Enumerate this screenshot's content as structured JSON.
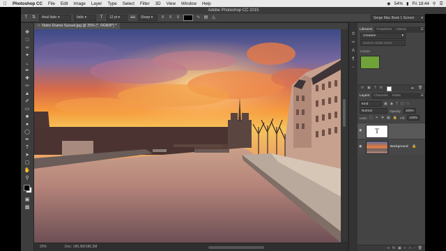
{
  "menubar": {
    "app": "Photoshop CC",
    "items": [
      "File",
      "Edit",
      "Image",
      "Layer",
      "Type",
      "Select",
      "Filter",
      "3D",
      "View",
      "Window",
      "Help"
    ],
    "battery": "54%",
    "clock": "Fri 18:44"
  },
  "window": {
    "title": "Adobe Photoshop CC 2015"
  },
  "options": {
    "font_family": "Arial Italic",
    "font_style": "Italic",
    "font_size": "12 pt",
    "aa_label": "aa",
    "antialias": "Sharp"
  },
  "workspace": "Serge Mac Book 1 Screen",
  "document": {
    "tab_close": "×",
    "tab_title": "Notre Drame Sunset.jpg @ 25% (*, RGB/8*) *",
    "zoom": "25%",
    "doc_info": "Doc: 186,3M/186,3M"
  },
  "libraries": {
    "tabs": [
      "Libraries",
      "Properties",
      "History"
    ],
    "library_name": "Creature",
    "search_placeholder": "Search Adobe Stock",
    "colors_label": "Colors",
    "color_hex": "#70a23a"
  },
  "layers": {
    "tabs": [
      "Layers",
      "Channels",
      "Paths"
    ],
    "kind": "Kind",
    "blend_mode": "Normal",
    "opacity_label": "Opacity:",
    "opacity_value": "100%",
    "lock_label": "Lock:",
    "fill_label": "Fill:",
    "fill_value": "100%",
    "items": [
      {
        "name": "",
        "type": "text"
      },
      {
        "name": "Background",
        "type": "image"
      }
    ]
  },
  "colors": {
    "fg": "#000000",
    "bg": "#ffffff"
  }
}
